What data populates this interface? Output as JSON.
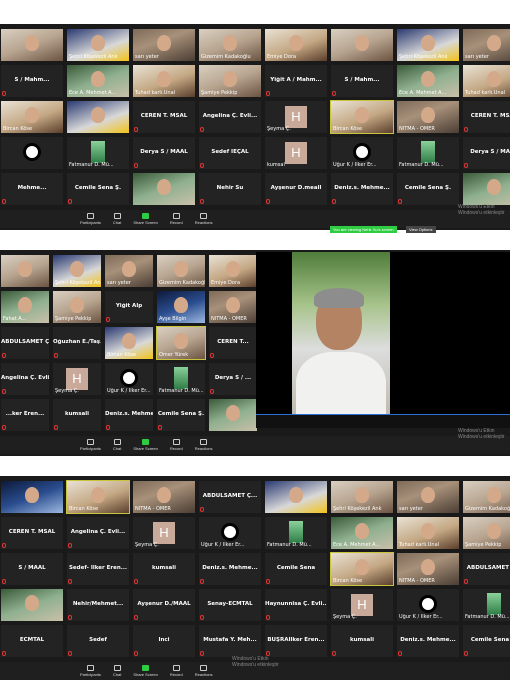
{
  "panel1": {
    "rows": [
      [
        {
          "name": "",
          "type": "photo",
          "v": "p2"
        },
        {
          "name": "Şehri Köşekezil Ank",
          "type": "photo",
          "v": "p3"
        },
        {
          "name": "sarı yeter",
          "type": "photo"
        },
        {
          "name": "Gizemim Kadakoğlu",
          "type": "photo",
          "v": "p2"
        },
        {
          "name": "Emiye Dora",
          "type": "photo",
          "v": "p5"
        },
        {
          "name": "",
          "type": "photo",
          "v": "p2"
        },
        {
          "name": "Şehri Köşekezil Ank",
          "type": "photo",
          "v": "p3"
        },
        {
          "name": "sarı yeter",
          "type": "photo"
        }
      ],
      [
        {
          "label": "S / Mahm...",
          "type": "name"
        },
        {
          "name": "Ece A. Mehmet A...",
          "type": "photo",
          "v": "p4"
        },
        {
          "name": "Tuhad karlı.Ünal",
          "type": "photo",
          "v": "p5"
        },
        {
          "name": "Şamiye Pekkip",
          "type": "photo",
          "v": "p2"
        },
        {
          "label": "Yiğit A / Mahm...",
          "type": "name"
        },
        {
          "label": "S / Mahm...",
          "type": "name"
        },
        {
          "name": "Ece A. Mehmet A...",
          "type": "photo",
          "v": "p4"
        },
        {
          "name": "Tuhad karlı.Ünal",
          "type": "photo",
          "v": "p5"
        }
      ],
      [
        {
          "name": "Bircan Köse",
          "type": "photo",
          "v": "p5"
        },
        {
          "name": "",
          "type": "photo",
          "v": "p3"
        },
        {
          "label": "CEREN T. MSAL",
          "type": "name"
        },
        {
          "label": "Angelina Ç. Evli...",
          "type": "name"
        },
        {
          "name": "Şeyma Ç.",
          "type": "h"
        },
        {
          "name": "Bircan Köse",
          "type": "photo",
          "v": "p5",
          "active": true
        },
        {
          "name": "NİTMA - ÖMER",
          "type": "photo"
        },
        {
          "label": "CEREN T. MSAL",
          "type": "name"
        }
      ],
      [
        {
          "name": "",
          "type": "avatar"
        },
        {
          "name": "Fatmanur D. Mü...",
          "type": "mini"
        },
        {
          "label": "Derya S / MAAL",
          "type": "name"
        },
        {
          "label": "Sedef İEÇAL",
          "type": "name"
        },
        {
          "name": "kumsal",
          "type": "h"
        },
        {
          "name": "Uğur K / İlker Er...",
          "type": "avatar"
        },
        {
          "name": "Fatmanur D. Mü...",
          "type": "mini"
        },
        {
          "label": "Derya S / MAAL",
          "type": "name"
        }
      ],
      [
        {
          "label": "Mehme...",
          "type": "name"
        },
        {
          "label": "Cemile Sena Ş.",
          "type": "name"
        },
        {
          "name": "",
          "type": "photo",
          "v": "p4"
        },
        {
          "label": "Nehir Su",
          "type": "name"
        },
        {
          "label": "Ayşenur D.meall",
          "type": "name"
        },
        {
          "label": "Deniz.s. Mehme...",
          "type": "name"
        },
        {
          "label": "Cemile Sena Ş.",
          "type": "name"
        },
        {
          "name": "",
          "type": "photo",
          "v": "p4"
        }
      ]
    ],
    "toolbar": [
      "Participants",
      "Chat",
      "Share Screen",
      "Record",
      "Reactions"
    ],
    "watermark": [
      "Windows'u Etkin",
      "Windows'u etkinleştir"
    ],
    "share_banner": "You are viewing Nehir Su's screen",
    "view_options": "View Options"
  },
  "panel2": {
    "rows": [
      [
        {
          "name": "",
          "type": "photo",
          "v": "p2"
        },
        {
          "name": "Şehri Köşekezil Ank",
          "type": "photo",
          "v": "p3"
        },
        {
          "name": "sarı yeter",
          "type": "photo"
        },
        {
          "name": "Gizemim Kadakoğlu",
          "type": "photo",
          "v": "p2"
        },
        {
          "name": "Emiye Dora",
          "type": "photo",
          "v": "p5"
        }
      ],
      [
        {
          "name": "Fahat A...",
          "type": "photo",
          "v": "p4"
        },
        {
          "name": "Şamiye Pekkip",
          "type": "photo",
          "v": "p2"
        },
        {
          "label": "Yiğit Alp",
          "type": "name"
        },
        {
          "name": "Ayşe Bilgin",
          "type": "photo",
          "v": "p6"
        },
        {
          "name": "NİTMA - ÖMER",
          "type": "photo"
        }
      ],
      [
        {
          "label": "ABDULSAMET Ç...",
          "type": "name"
        },
        {
          "label": "Oğuzhan E./Taş...",
          "type": "name"
        },
        {
          "name": "Bircan Köse",
          "type": "photo",
          "v": "p3"
        },
        {
          "name": "Ömer Yürek",
          "type": "photo",
          "v": "p2",
          "active": true
        },
        {
          "label": "CEREN T...",
          "type": "name"
        }
      ],
      [
        {
          "label": "Angelina Ç. Evli...",
          "type": "name"
        },
        {
          "name": "Şeyma Ç.",
          "type": "h"
        },
        {
          "name": "Uğur K / İlker Er...",
          "type": "avatar"
        },
        {
          "name": "Fatmanur D. Mü...",
          "type": "mini"
        },
        {
          "label": "Derya S / ...",
          "type": "name"
        }
      ],
      [
        {
          "label": "...ker Eren...",
          "type": "name"
        },
        {
          "label": "kumsali",
          "type": "name"
        },
        {
          "label": "Deniz.s. Mehme...",
          "type": "name"
        },
        {
          "label": "Cemile Sena Ş.",
          "type": "name"
        },
        {
          "name": "",
          "type": "photo",
          "v": "p4"
        }
      ]
    ],
    "toolbar": [
      "Participants",
      "Chat",
      "Share Screen",
      "Record",
      "Reactions"
    ],
    "watermark": [
      "Windows'u Etkin",
      "Windows'u etkinleştir"
    ]
  },
  "panel3": {
    "rows": [
      [
        {
          "name": "",
          "type": "photo",
          "v": "p6"
        },
        {
          "name": "Bircan Köse",
          "type": "photo",
          "v": "p5",
          "active": true
        },
        {
          "name": "NİTMA - ÖMER",
          "type": "photo"
        },
        {
          "label": "ABDULSAMET Ç...",
          "type": "name"
        },
        {
          "name": "",
          "type": "photo",
          "v": "p3"
        },
        {
          "name": "Şehri Köşekezil Ank",
          "type": "photo",
          "v": "p2"
        },
        {
          "name": "sarı yeter",
          "type": "photo"
        },
        {
          "name": "Gizemim Kadakoğlu",
          "type": "photo",
          "v": "p2"
        }
      ],
      [
        {
          "label": "CEREN T. MSAL",
          "type": "name"
        },
        {
          "label": "Angelina Ç. Evli...",
          "type": "name"
        },
        {
          "name": "Şeyma Ç.",
          "type": "h"
        },
        {
          "name": "Uğur K / İlker Er...",
          "type": "avatar"
        },
        {
          "name": "Fatmanur D. Mü...",
          "type": "mini"
        },
        {
          "name": "Ece A. Mehmet A...",
          "type": "photo",
          "v": "p4"
        },
        {
          "name": "Tuhad karlı.Ünal",
          "type": "photo",
          "v": "p5"
        },
        {
          "name": "Şamiye Pekkip",
          "type": "photo",
          "v": "p2"
        }
      ],
      [
        {
          "label": "S / MAAL",
          "type": "name"
        },
        {
          "label": "Sedef- İlker Eren...",
          "type": "name"
        },
        {
          "label": "kumsali",
          "type": "name"
        },
        {
          "label": "Deniz.s. Mehme...",
          "type": "name"
        },
        {
          "label": "Cemile Sena",
          "type": "name"
        },
        {
          "name": "Bircan Köse",
          "type": "photo",
          "v": "p5",
          "active": true
        },
        {
          "name": "NİTMA - ÖMER",
          "type": "photo"
        },
        {
          "label": "ABDULSAMET Ç...",
          "type": "name"
        }
      ],
      [
        {
          "name": "",
          "type": "photo",
          "v": "p4"
        },
        {
          "label": "Nehir/Mehmet...",
          "type": "name"
        },
        {
          "label": "Ayşenur D./MAAL",
          "type": "name"
        },
        {
          "label": "Senay-ECMTAL",
          "type": "name"
        },
        {
          "label": "Haynunnisa Ç. Evli...",
          "type": "name"
        },
        {
          "name": "Şeyma Ç.",
          "type": "h"
        },
        {
          "name": "Uğur K / İlker Er...",
          "type": "avatar"
        },
        {
          "name": "Fatmanur D. Mü...",
          "type": "mini"
        }
      ],
      [
        {
          "label": "ECMTAL",
          "type": "name"
        },
        {
          "label": "Sedef",
          "type": "name"
        },
        {
          "label": "İnci",
          "type": "name"
        },
        {
          "label": "Mustafa Y. Meh...",
          "type": "name"
        },
        {
          "label": "BÜŞRAİlker Eren...",
          "type": "name"
        },
        {
          "label": "kumsali",
          "type": "name"
        },
        {
          "label": "Deniz.s. Mehme...",
          "type": "name"
        },
        {
          "label": "Cemile Sena Ş.",
          "type": "name"
        }
      ]
    ],
    "toolbar": [
      "Participants",
      "Chat",
      "Share Screen",
      "Record",
      "Reactions"
    ],
    "watermark": [
      "Windows'u Etkin",
      "Windows'u etkinleştir"
    ]
  }
}
